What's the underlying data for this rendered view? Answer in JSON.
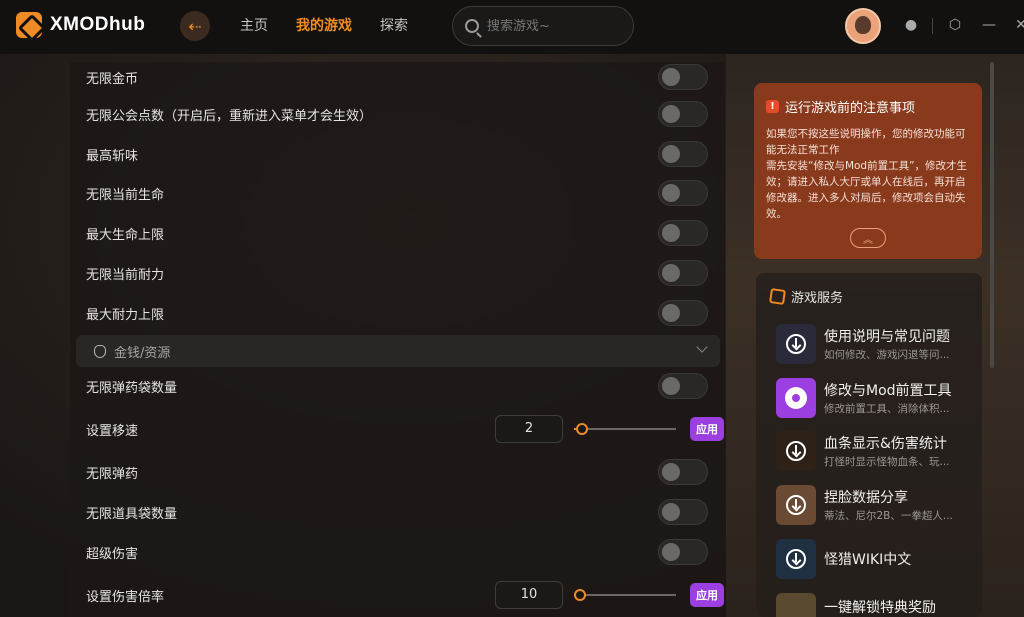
{
  "header": {
    "logo_text": "XMODhub",
    "nav": [
      {
        "label": "主页",
        "active": false
      },
      {
        "label": "我的游戏",
        "active": true
      },
      {
        "label": "探索",
        "active": false
      }
    ],
    "search_placeholder": "搜索游戏~",
    "accent_color": "#f08a24"
  },
  "cheats": {
    "rows_top": [
      {
        "label": "无限金币"
      },
      {
        "label": "无限公会点数（开启后，重新进入菜单才会生效）"
      },
      {
        "label": "最高斩味"
      },
      {
        "label": "无限当前生命"
      },
      {
        "label": "最大生命上限"
      },
      {
        "label": "无限当前耐力"
      },
      {
        "label": "最大耐力上限"
      }
    ],
    "section": {
      "label": "金钱/资源"
    },
    "rows_bottom": [
      {
        "label": "无限弹药袋数量"
      },
      {
        "label": "设置移速",
        "value": "2",
        "apply_label": "应用"
      },
      {
        "label": "无限弹药"
      },
      {
        "label": "无限道具袋数量"
      },
      {
        "label": "超级伤害"
      },
      {
        "label": "设置伤害倍率",
        "value": "10",
        "apply_label": "应用"
      }
    ]
  },
  "notice": {
    "title": "运行游戏前的注意事项",
    "body": "如果您不按这些说明操作，您的修改功能可能无法正常工作\n需先安装“修改与Mod前置工具”，修改才生效；请进入私人大厅或单人在线后，再开启修改器。进入多人对局后，修改项会自动失效。"
  },
  "services": {
    "title": "游戏服务",
    "items": [
      {
        "title": "使用说明与常见问题",
        "desc": "如何修改、游戏闪退等问..."
      },
      {
        "title": "修改与Mod前置工具",
        "desc": "修改前置工具、消除体积..."
      },
      {
        "title": "血条显示&伤害统计",
        "desc": "打怪时显示怪物血条、玩..."
      },
      {
        "title": "捏脸数据分享",
        "desc": "蒂法、尼尔2B、一拳超人..."
      },
      {
        "title": "怪猎WIKI中文",
        "desc": ""
      },
      {
        "title": "一键解锁特典奖励",
        "desc": ""
      }
    ]
  }
}
